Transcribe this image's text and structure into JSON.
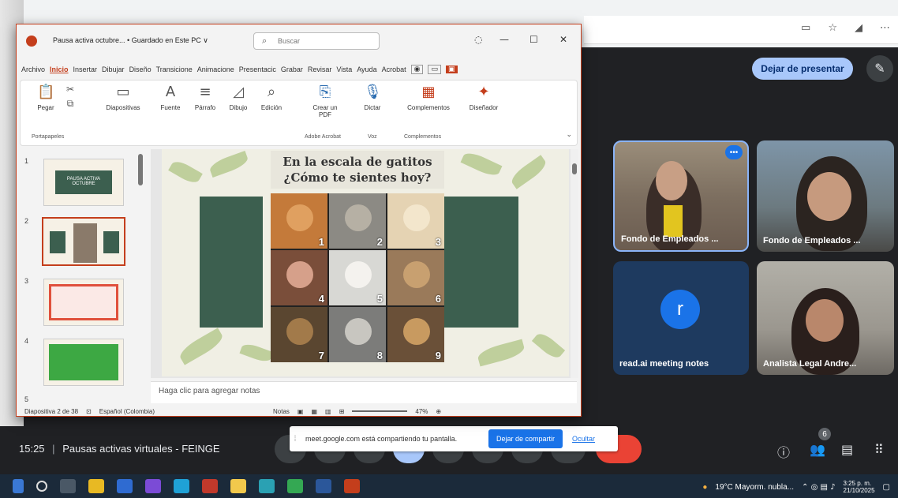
{
  "meet": {
    "present_button": "Dejar de presentar",
    "meeting_time": "15:25",
    "meeting_separator": "|",
    "meeting_title": "Pausas activas virtuales - FEINGE",
    "participant_count": "6",
    "participants": [
      {
        "name": "Fondo de Empleados ..."
      },
      {
        "name": "Fondo de Empleados ..."
      },
      {
        "name": "read.ai meeting notes",
        "initial": "r"
      },
      {
        "name": "Analista Legal Andre..."
      }
    ],
    "share_bar": {
      "message": "meet.google.com está compartiendo tu pantalla.",
      "stop_label": "Dejar de compartir",
      "hide_label": "Ocultar"
    }
  },
  "ppt": {
    "file_title": "Pausa activa octubre... • Guardado en Este PC ∨",
    "search_placeholder": "Buscar",
    "menu": [
      "Archivo",
      "Inicio",
      "Insertar",
      "Dibujar",
      "Diseño",
      "Transicione",
      "Animacione",
      "Presentacic",
      "Grabar",
      "Revisar",
      "Vista",
      "Ayuda",
      "Acrobat"
    ],
    "ribbon": {
      "pegar": "Pegar",
      "diapositivas": "Diapositivas",
      "fuente": "Fuente",
      "parrafo": "Párrafo",
      "dibujo": "Dibujo",
      "edicion": "Edición",
      "crear_pdf": "Crear un PDF",
      "dictar": "Dictar",
      "complementos": "Complementos",
      "disenador": "Diseñador",
      "group_portapapeles": "Portapapeles",
      "group_adobe": "Adobe Acrobat",
      "group_voz": "Voz",
      "group_complementos": "Complementos"
    },
    "thumb_numbers": [
      "1",
      "2",
      "3",
      "4",
      "5"
    ],
    "thumb1_text": "PAUSA ACTIVA OCTUBRE",
    "slide": {
      "title_line1": "En la escala de gatitos",
      "title_line2": "¿Cómo te sientes hoy?",
      "cat_numbers": [
        "1",
        "2",
        "3",
        "4",
        "5",
        "6",
        "7",
        "8",
        "9"
      ]
    },
    "notes_placeholder": "Haga clic para agregar notas",
    "status": {
      "slide_count": "Diapositiva 2 de 38",
      "language": "Español (Colombia)",
      "notes": "Notas",
      "zoom": "47%"
    }
  },
  "taskbar": {
    "weather": "19°C  Mayorm. nubla...",
    "time": "3:25 p. m.",
    "date": "21/10/2025"
  },
  "colors": {
    "meet_bg": "#202124",
    "ppt_accent": "#c43e1c",
    "present_button": "#a8c7fa",
    "stop_share": "#1a73e8",
    "slide_green": "#3c5f4f"
  }
}
